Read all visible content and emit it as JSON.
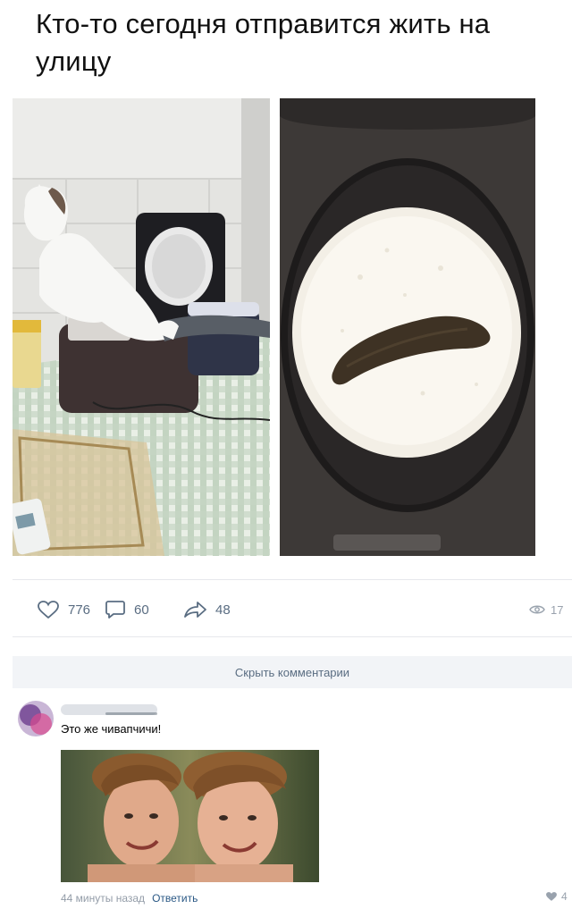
{
  "post": {
    "title": "Кто-то сегодня отправится жить на улицу"
  },
  "actions": {
    "likes": "776",
    "comments": "60",
    "shares": "48",
    "views": "17"
  },
  "comments_section": {
    "hide_label": "Скрыть комментарии"
  },
  "comment": {
    "text": "Это же чивапчичи!",
    "time": "44 минуты назад",
    "reply_label": "Ответить",
    "likes": "4"
  },
  "colors": {
    "accent": "#2a5885",
    "icon": "#5a6d82",
    "muted": "#939ca8",
    "bar": "#f2f4f7"
  }
}
